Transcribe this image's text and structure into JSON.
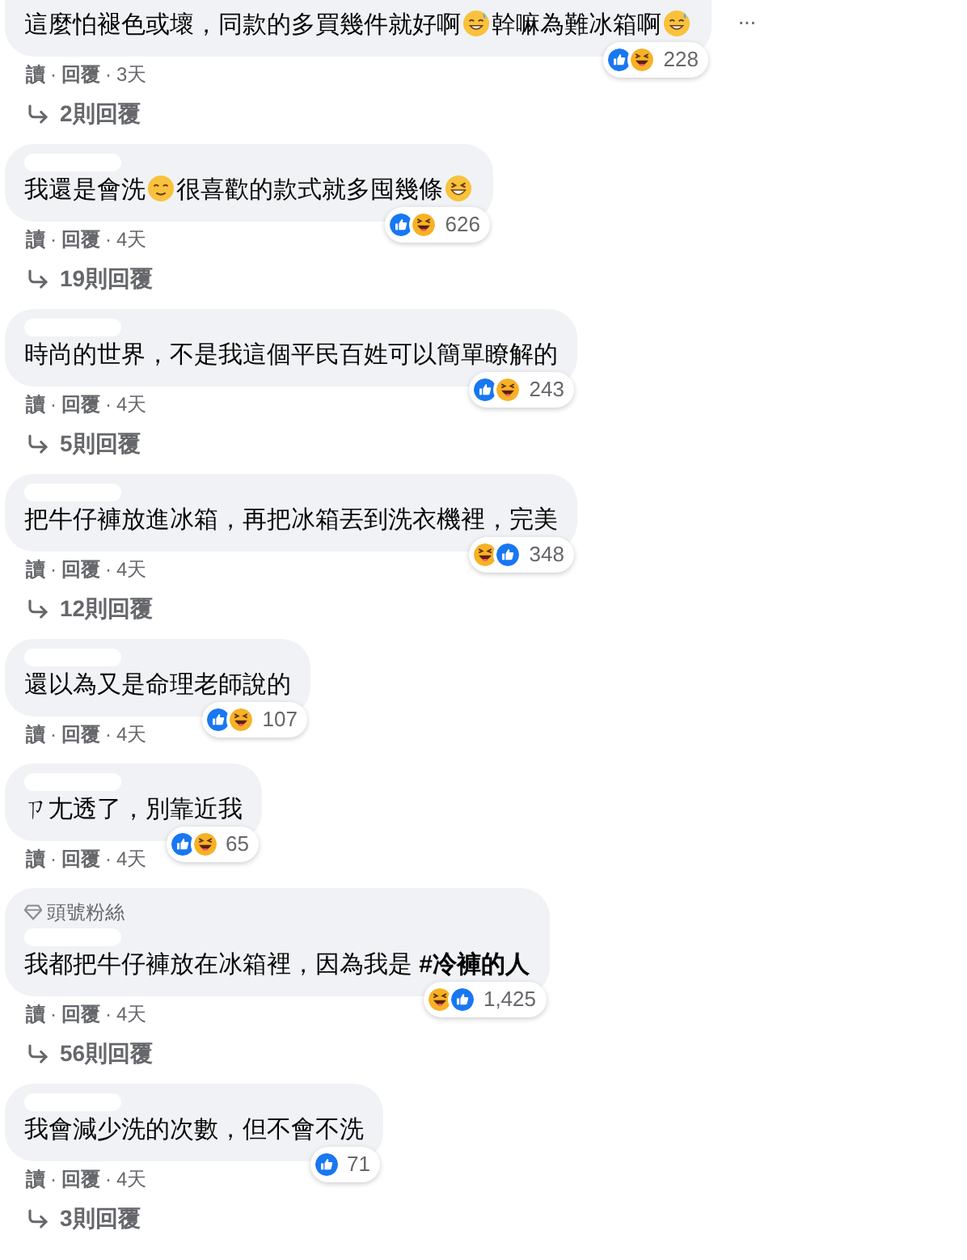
{
  "comments": [
    {
      "name_redacted": false,
      "segments": [
        {
          "kind": "text",
          "text": "這麼怕褪色或壞，同款的多買幾件就好啊"
        },
        {
          "kind": "emoji-sweat"
        },
        {
          "kind": "text",
          "text": "幹嘛為難冰箱啊"
        },
        {
          "kind": "emoji-sweat"
        }
      ],
      "reactions": [
        {
          "kind": "like"
        },
        {
          "kind": "haha"
        }
      ],
      "count": "228",
      "actions": [
        "讀",
        "回覆"
      ],
      "separator": "·",
      "time": "3天",
      "replies": "2則回覆",
      "more": "···"
    },
    {
      "name_redacted": true,
      "segments": [
        {
          "kind": "text",
          "text": "我還是會洗"
        },
        {
          "kind": "emoji-relieved"
        },
        {
          "kind": "text",
          "text": "很喜歡的款式就多囤幾條"
        },
        {
          "kind": "emoji-laugh"
        }
      ],
      "reactions": [
        {
          "kind": "like"
        },
        {
          "kind": "haha"
        }
      ],
      "count": "626",
      "actions": [
        "讀",
        "回覆"
      ],
      "separator": "·",
      "time": "4天",
      "replies": "19則回覆"
    },
    {
      "name_redacted": true,
      "segments": [
        {
          "kind": "text",
          "text": "時尚的世界，不是我這個平民百姓可以簡單瞭解的"
        }
      ],
      "reactions": [
        {
          "kind": "like"
        },
        {
          "kind": "haha"
        }
      ],
      "count": "243",
      "actions": [
        "讀",
        "回覆"
      ],
      "separator": "·",
      "time": "4天",
      "replies": "5則回覆"
    },
    {
      "name_redacted": true,
      "segments": [
        {
          "kind": "text",
          "text": "把牛仔褲放進冰箱，再把冰箱丟到洗衣機裡，完美"
        }
      ],
      "reactions": [
        {
          "kind": "haha"
        },
        {
          "kind": "like"
        }
      ],
      "count": "348",
      "actions": [
        "讀",
        "回覆"
      ],
      "separator": "·",
      "time": "4天",
      "replies": "12則回覆"
    },
    {
      "name_redacted": true,
      "segments": [
        {
          "kind": "text",
          "text": "還以為又是命理老師說的"
        }
      ],
      "reactions": [
        {
          "kind": "like"
        },
        {
          "kind": "haha"
        }
      ],
      "count": "107",
      "actions": [
        "讀",
        "回覆"
      ],
      "separator": "·",
      "time": "4天"
    },
    {
      "name_redacted": true,
      "segments": [
        {
          "kind": "text",
          "text": "ㄗ尢透了，別靠近我"
        }
      ],
      "reactions": [
        {
          "kind": "like"
        },
        {
          "kind": "haha"
        }
      ],
      "count": "65",
      "actions": [
        "讀",
        "回覆"
      ],
      "separator": "·",
      "time": "4天"
    },
    {
      "name_redacted": true,
      "badge": "頭號粉絲",
      "segments": [
        {
          "kind": "text",
          "text": "我都把牛仔褲放在冰箱裡，因為我是 "
        },
        {
          "kind": "hashtag",
          "text": "#冷褲的人"
        }
      ],
      "reactions": [
        {
          "kind": "haha"
        },
        {
          "kind": "like"
        }
      ],
      "count": "1,425",
      "actions": [
        "讀",
        "回覆"
      ],
      "separator": "·",
      "time": "4天",
      "replies": "56則回覆"
    },
    {
      "name_redacted": true,
      "segments": [
        {
          "kind": "text",
          "text": "我會減少洗的次數，但不會不洗"
        }
      ],
      "reactions": [
        {
          "kind": "like"
        }
      ],
      "count": "71",
      "actions": [
        "讀",
        "回覆"
      ],
      "separator": "·",
      "time": "4天",
      "replies": "3則回覆"
    }
  ]
}
